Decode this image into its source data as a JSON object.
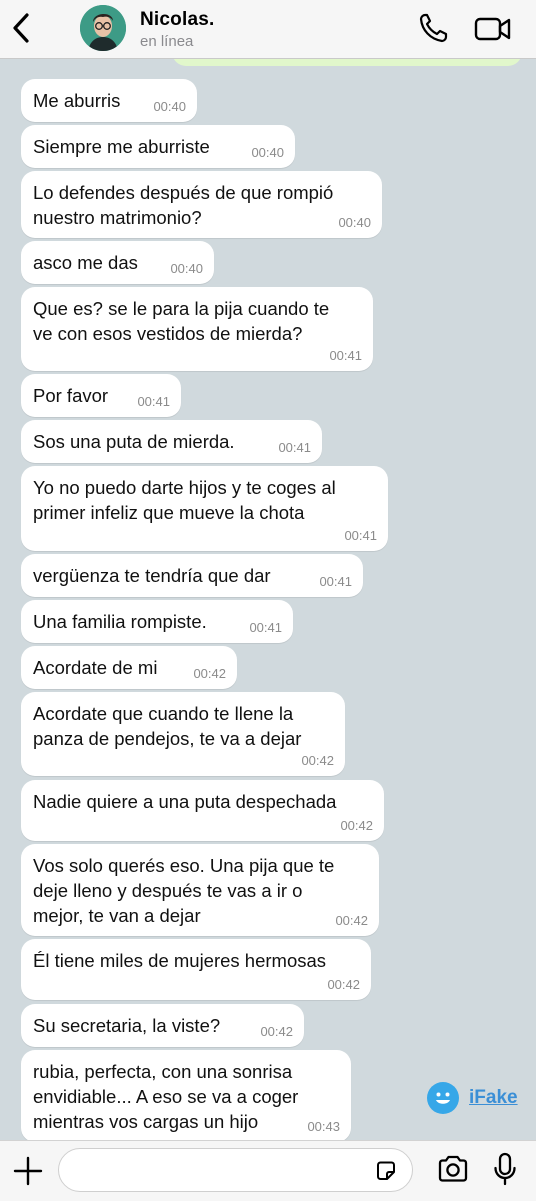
{
  "header": {
    "back_icon": "chevron-left-icon",
    "contact_name": "Nicolas.",
    "contact_status": "en línea",
    "call_icon": "phone-icon",
    "video_icon": "video-camera-icon"
  },
  "messages": [
    {
      "text": "Me aburris",
      "time": "00:40"
    },
    {
      "text": "Siempre me aburriste",
      "time": "00:40"
    },
    {
      "text": "Lo defendes después de que rompió\nnuestro matrimonio?",
      "time": "00:40"
    },
    {
      "text": "asco me das",
      "time": "00:40"
    },
    {
      "text": "Que es? se le para la pija cuando te\nve con esos vestidos de mierda?",
      "time": "00:41"
    },
    {
      "text": "Por favor",
      "time": "00:41"
    },
    {
      "text": "Sos una puta de mierda.",
      "time": "00:41"
    },
    {
      "text": "Yo no puedo darte hijos y te coges al\nprimer infeliz que mueve la chota",
      "time": "00:41"
    },
    {
      "text": "vergüenza te tendría que dar",
      "time": "00:41"
    },
    {
      "text": "Una familia rompiste.",
      "time": "00:41"
    },
    {
      "text": "Acordate de mi",
      "time": "00:42"
    },
    {
      "text": "Acordate que cuando te llene la\npanza de pendejos, te va a dejar",
      "time": "00:42"
    },
    {
      "text": "Nadie quiere a una puta despechada",
      "time": "00:42"
    },
    {
      "text": "Vos solo querés eso. Una pija que te\ndeje lleno y después te vas a ir o\nmejor, te van a dejar",
      "time": "00:42"
    },
    {
      "text": "Él tiene miles de mujeres hermosas",
      "time": "00:42"
    },
    {
      "text": "Su secretaria, la viste?",
      "time": "00:42"
    },
    {
      "text": "rubia, perfecta, con una sonrisa\nenvidiable... A eso se va a coger\nmientras vos cargas un hijo",
      "time": "00:43"
    }
  ],
  "watermark": {
    "label": "iFake",
    "icon": "smiley-icon",
    "color": "#36a7e8"
  },
  "input_bar": {
    "add_icon": "plus-icon",
    "message_value": "",
    "message_placeholder": "",
    "sticker_icon": "sticker-icon",
    "camera_icon": "camera-icon",
    "mic_icon": "microphone-icon"
  },
  "colors": {
    "chat_background": "#d0d9dd",
    "incoming_bubble": "#ffffff",
    "outgoing_bubble": "#e1f7cb",
    "header_background": "#f6f6f6",
    "timestamp": "#8b8b8b"
  }
}
